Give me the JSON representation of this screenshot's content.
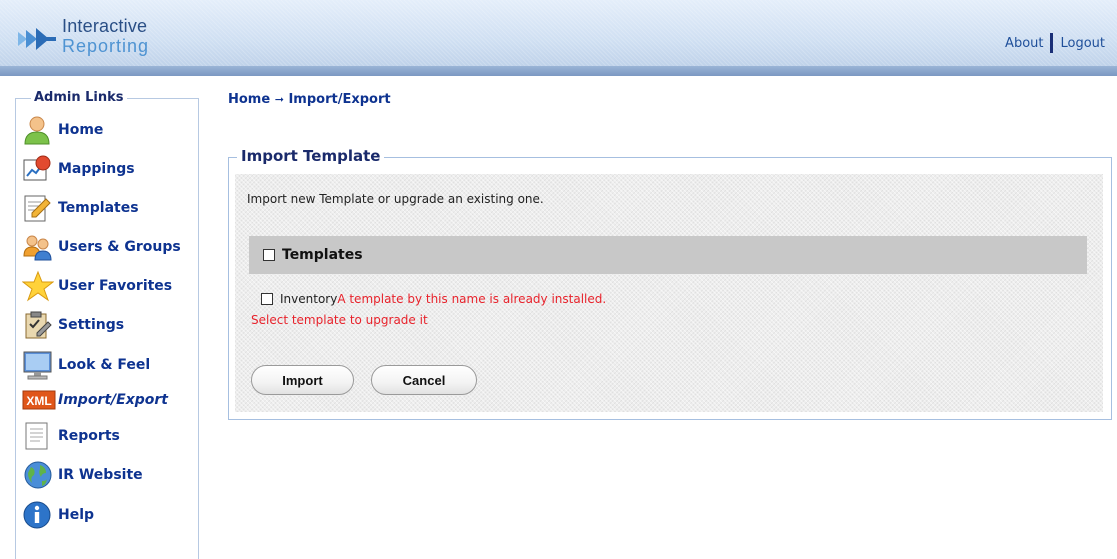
{
  "header": {
    "logo_line1": "Interactive",
    "logo_line2": "Reporting",
    "links": {
      "about": "About",
      "logout": "Logout"
    }
  },
  "sidebar": {
    "legend": "Admin Links",
    "items": [
      {
        "label": "Home",
        "icon": "person-icon"
      },
      {
        "label": "Mappings",
        "icon": "chart-icon"
      },
      {
        "label": "Templates",
        "icon": "document-pencil-icon"
      },
      {
        "label": "Users & Groups",
        "icon": "users-icon"
      },
      {
        "label": "User Favorites",
        "icon": "star-icon"
      },
      {
        "label": "Settings",
        "icon": "clipboard-settings-icon"
      },
      {
        "label": "Look & Feel",
        "icon": "monitor-icon"
      },
      {
        "label": "Import/Export",
        "icon": "xml-icon",
        "icon_text": "XML",
        "active": true
      },
      {
        "label": "Reports",
        "icon": "report-icon"
      },
      {
        "label": "IR Website",
        "icon": "globe-icon"
      },
      {
        "label": "Help",
        "icon": "info-icon"
      }
    ]
  },
  "breadcrumb": {
    "home": "Home",
    "arrow": "➞",
    "current": "Import/Export"
  },
  "import_template": {
    "legend": "Import Template",
    "intro": "Import new Template or upgrade an existing one.",
    "templates_label": "Templates",
    "templates_checked": false,
    "inventory_label": "Inventory",
    "inventory_checked": false,
    "warning_line1": "A template by this name is already installed.",
    "warning_line2": "Select template to upgrade it",
    "import_button": "Import",
    "cancel_button": "Cancel"
  },
  "colors": {
    "link": "#0e3390",
    "heading": "#1a2a6b",
    "warning": "#e8232c",
    "border": "#a6bfe0"
  }
}
